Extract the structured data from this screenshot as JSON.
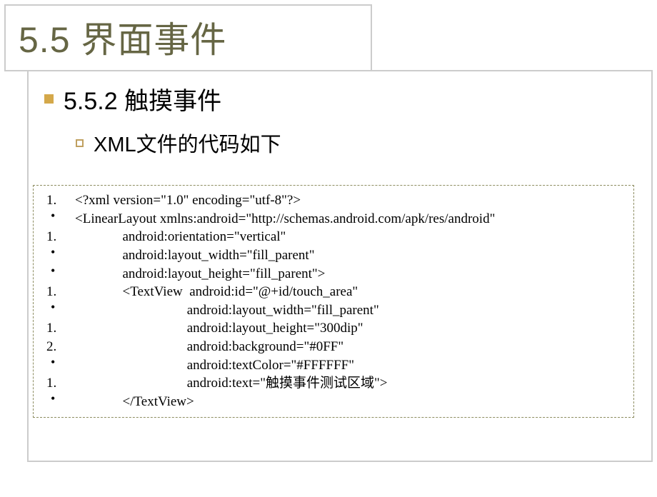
{
  "title": "5.5  界面事件",
  "subtitle": "5.5.2 触摸事件",
  "subheading": "XML文件的代码如下",
  "code_lines": [
    {
      "marker": "1.",
      "text": "<?xml version=\"1.0\" encoding=\"utf-8\"?>"
    },
    {
      "marker": "•",
      "text": "<LinearLayout xmlns:android=\"http://schemas.android.com/apk/res/android\""
    },
    {
      "marker": "1.",
      "text": "              android:orientation=\"vertical\""
    },
    {
      "marker": "•",
      "text": "              android:layout_width=\"fill_parent\""
    },
    {
      "marker": "•",
      "text": "              android:layout_height=\"fill_parent\">"
    },
    {
      "marker": "1.",
      "text": "              <TextView  android:id=\"@+id/touch_area\""
    },
    {
      "marker": "•",
      "text": "                                 android:layout_width=\"fill_parent\""
    },
    {
      "marker": "1.",
      "text": "                                 android:layout_height=\"300dip\""
    },
    {
      "marker": "2.",
      "text": "                                 android:background=\"#0FF\""
    },
    {
      "marker": "•",
      "text": "                                 android:textColor=\"#FFFFFF\""
    },
    {
      "marker": "1.",
      "text": "                                 android:text=\"触摸事件测试区域\">"
    },
    {
      "marker": "•",
      "text": "              </TextView>"
    }
  ]
}
